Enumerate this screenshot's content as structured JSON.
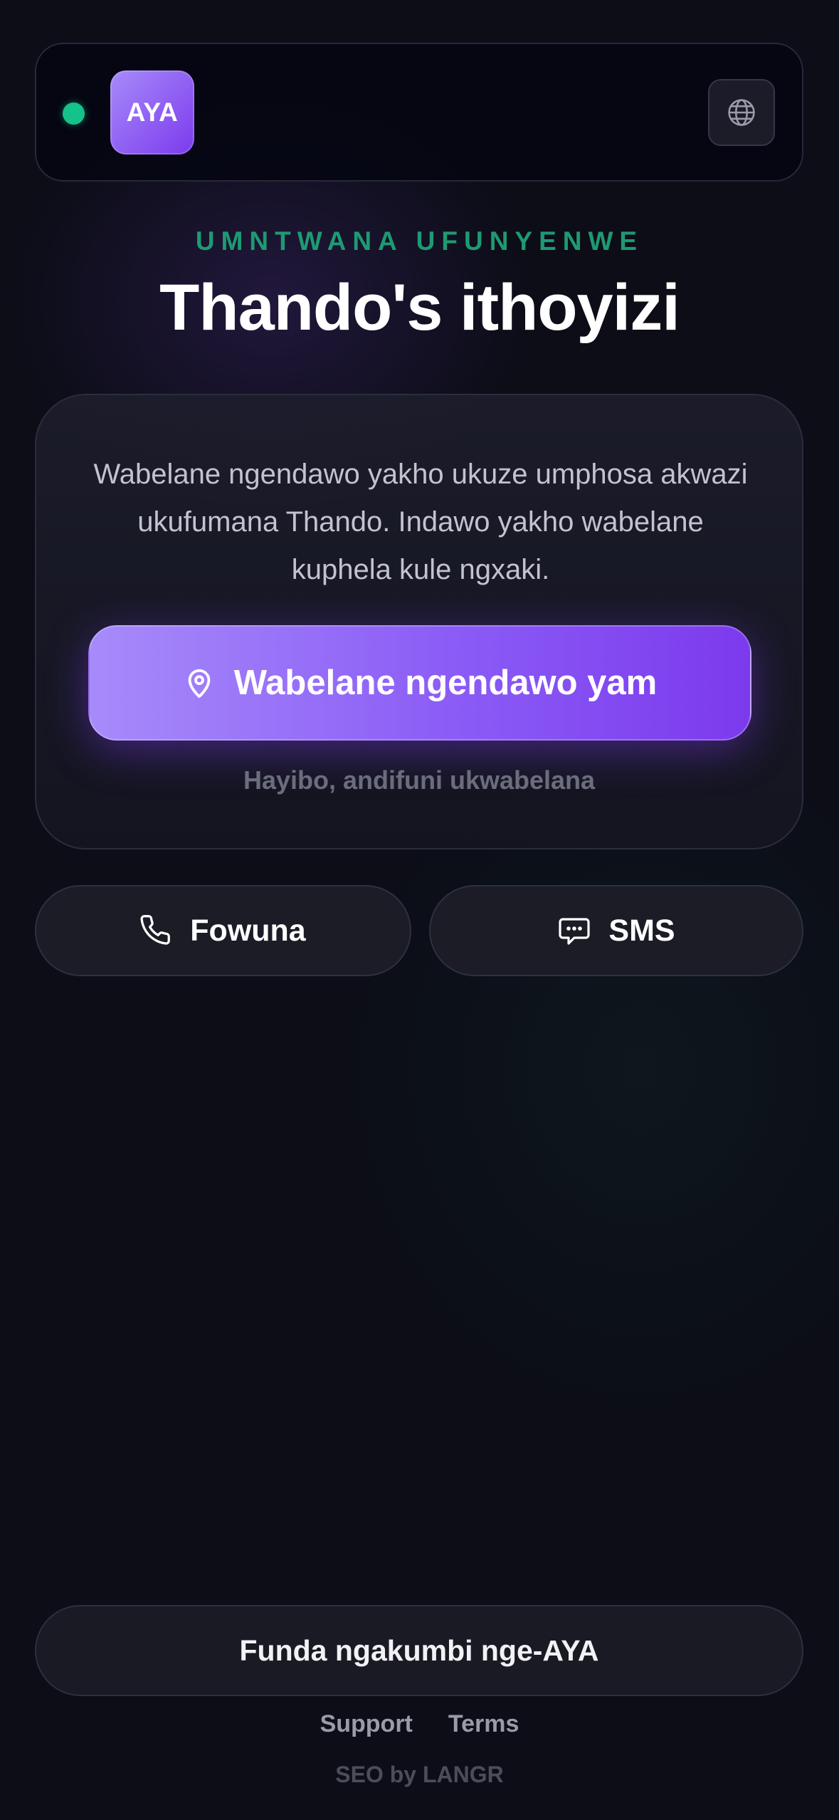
{
  "header": {
    "logo_text": "AYA",
    "status": "online",
    "language_icon": "globe-icon"
  },
  "hero": {
    "eyebrow": "UMNTWANA UFUNYENWE",
    "title": "Thando's ithoyizi"
  },
  "card": {
    "description": "Wabelane ngendawo yakho ukuze umphosa akwazi ukufumana Thando. Indawo yakho wabelane kuphela kule ngxaki.",
    "share_button": {
      "label": "Wabelane ngendawo yam",
      "icon": "location-pin-icon"
    },
    "decline_link": "Hayibo, andifuni ukwabelana"
  },
  "contact": {
    "call": {
      "label": "Fowuna",
      "icon": "phone-icon"
    },
    "sms": {
      "label": "SMS",
      "icon": "chat-bubble-icon"
    }
  },
  "footer": {
    "learn_more": "Funda ngakumbi nge-AYA",
    "links": [
      "Support",
      "Terms"
    ],
    "credit": "SEO by LANGR"
  },
  "colors": {
    "accent": "#8b5cf6",
    "accent_light": "#a78bfa",
    "status_green": "#14c28a",
    "eyebrow_green": "#1e9a72",
    "background": "#0c0d17"
  }
}
